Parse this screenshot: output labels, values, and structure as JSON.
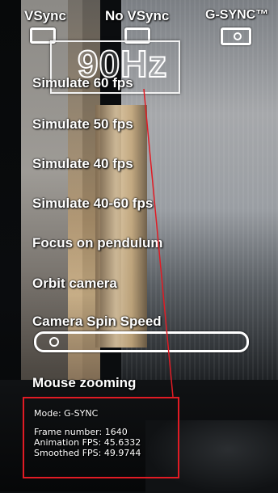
{
  "modes": {
    "vsync": "VSync",
    "no_vsync": "No VSync",
    "gsync": "G-SYNC™"
  },
  "refresh": {
    "label": "90Hz"
  },
  "menu": {
    "items": [
      "Simulate 60 fps",
      "Simulate 50 fps",
      "Simulate 40 fps",
      "Simulate 40-60 fps",
      "Focus on pendulum",
      "Orbit camera",
      "Camera Spin Speed",
      "Mouse zooming"
    ]
  },
  "camera_spin_speed": {
    "level": 0.04
  },
  "stats": {
    "mode": "Mode: G-SYNC",
    "frame_number": "Frame number: 1640",
    "animation_fps": "Animation FPS: 45.6332",
    "smoothed_fps": "Smoothed FPS: 49.9744"
  },
  "colors": {
    "text": "#ffffff",
    "annotation_red": "#e11b24"
  }
}
